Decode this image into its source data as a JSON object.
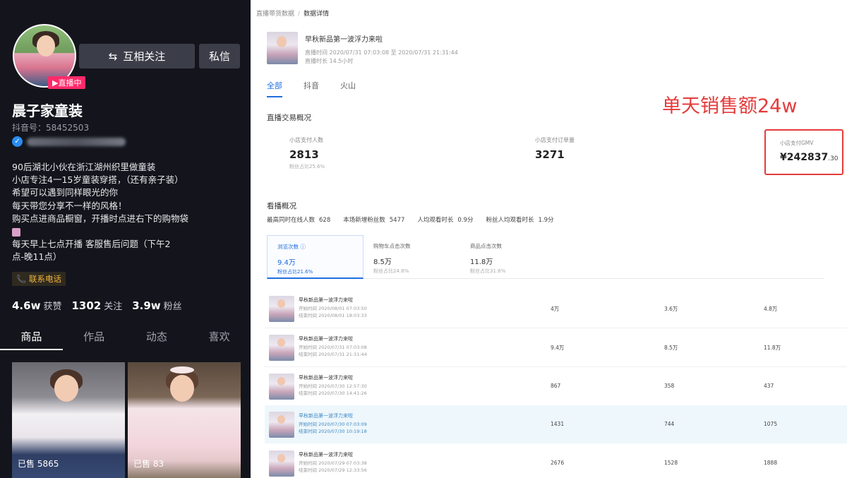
{
  "profile": {
    "live_badge": "▶直播中",
    "follow_btn": "互相关注",
    "follow_icon": "⇆",
    "msg_btn": "私信",
    "nickname": "晨子家童装",
    "douyin_id": "抖音号：58452503",
    "bio": [
      "90后湖北小伙在浙江湖州织里做童装",
      "小店专注4一15岁童装穿搭，（还有亲子装）",
      "希望可以遇到同样眼光的你",
      "每天带您分享不一样的风格！",
      "购买点进商品橱窗，开播时点进右下的购物袋",
      "每天早上七点开播     客服售后问题（下午2",
      "点-晚11点）"
    ],
    "contact": "📞 联系电话",
    "stats": [
      {
        "num": "4.6w",
        "label": "获赞"
      },
      {
        "num": "1302",
        "label": "关注"
      },
      {
        "num": "3.9w",
        "label": "粉丝"
      }
    ],
    "tabs": [
      "商品",
      "作品",
      "动态",
      "喜欢"
    ],
    "products": [
      {
        "sold": "已售 5865"
      },
      {
        "sold": "已售 83"
      }
    ]
  },
  "dashboard": {
    "breadcrumb": [
      "直播带货数据",
      "数据详情"
    ],
    "live": {
      "title": "早秋新品第一波浮力来啦",
      "time": "直播时间  2020/07/31 07:03:08 至 2020/07/31 21:31:44",
      "duration": "直播时长  14.5小时"
    },
    "tabs": [
      "全部",
      "抖音",
      "火山"
    ],
    "section_trade": "直播交易概况",
    "kpis": [
      {
        "label": "小店支付人数",
        "value": "2813",
        "sub": "粉丝占比25.6%"
      },
      {
        "label": "小店支付订单量",
        "value": "3271",
        "sub": ""
      }
    ],
    "gmv": {
      "label": "小店支付GMV",
      "value": "¥242837",
      "decimals": ".30"
    },
    "annotation": "单天销售额24w",
    "section_watch": "看播概况",
    "watch_stats": [
      {
        "label": "最高同时在线人数",
        "value": "628"
      },
      {
        "label": "本场新增粉丝数",
        "value": "5477"
      },
      {
        "label": "人均观看时长",
        "value": "0.9分"
      },
      {
        "label": "粉丝人均观看时长",
        "value": "1.9分"
      }
    ],
    "metric_cards": [
      {
        "label": "浏览次数 ⓘ",
        "value": "9.4万",
        "sub": "粉丝占比21.6%"
      },
      {
        "label": "购物车点击次数",
        "value": "8.5万",
        "sub": "粉丝占比24.8%"
      },
      {
        "label": "商品点击次数",
        "value": "11.8万",
        "sub": "粉丝占比31.6%"
      }
    ],
    "rows": [
      {
        "title": "早秋新品第一波浮力来啦",
        "start": "开始时间  2020/08/01 07:03:50",
        "end": "结束时间  2020/08/01 18:03:33",
        "c1": "4万",
        "c2": "3.6万",
        "c3": "4.8万"
      },
      {
        "title": "早秋新品第一波浮力来啦",
        "start": "开始时间  2020/07/31 07:03:08",
        "end": "结束时间  2020/07/31 21:31:44",
        "c1": "9.4万",
        "c2": "8.5万",
        "c3": "11.8万"
      },
      {
        "title": "早秋新品第一波浮力来啦",
        "start": "开始时间  2020/07/30 12:57:30",
        "end": "结束时间  2020/07/30 14:41:26",
        "c1": "867",
        "c2": "358",
        "c3": "437"
      },
      {
        "title": "早秋新品第一波浮力来啦",
        "start": "开始时间  2020/07/30 07:03:09",
        "end": "结束时间  2020/07/30 10:19:18",
        "c1": "1431",
        "c2": "744",
        "c3": "1075"
      },
      {
        "title": "早秋新品第一波浮力来啦",
        "start": "开始时间  2020/07/29 07:03:38",
        "end": "结束时间  2020/07/29 12:33:56",
        "c1": "2676",
        "c2": "1528",
        "c3": "1888"
      }
    ]
  }
}
